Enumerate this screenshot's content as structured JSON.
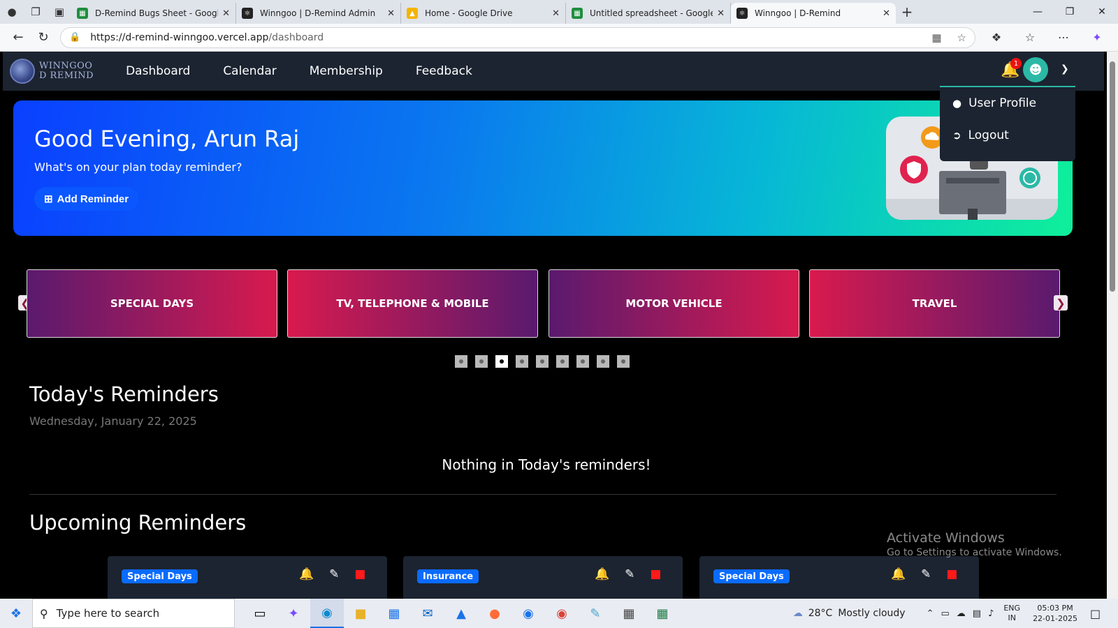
{
  "browser": {
    "tabs": [
      {
        "title": "D-Remind Bugs Sheet - Google Sh",
        "icon": "sheets-icon",
        "color": "#1e8e3e"
      },
      {
        "title": "Winngoo | D-Remind Admin",
        "icon": "react-icon",
        "color": "#222222"
      },
      {
        "title": "Home - Google Drive",
        "icon": "drive-icon",
        "color": "#f4b400"
      },
      {
        "title": "Untitled spreadsheet - Google Sh",
        "icon": "sheets-icon",
        "color": "#1e8e3e"
      },
      {
        "title": "Winngoo | D-Remind",
        "icon": "react-icon",
        "color": "#222222"
      }
    ],
    "url_host": "https://d-remind-winngoo.vercel.app",
    "url_path": "/dashboard"
  },
  "app": {
    "logo_line1": "WINNGOO",
    "logo_line2": "D REMIND",
    "nav": [
      "Dashboard",
      "Calendar",
      "Membership",
      "Feedback"
    ],
    "notification_count": "1",
    "dropdown": {
      "profile": "User Profile",
      "logout": "Logout"
    },
    "hero": {
      "greeting": "Good Evening, Arun Raj",
      "subtitle": "What's on your plan today reminder?",
      "add_button": "Add Reminder"
    },
    "categories": [
      "SPECIAL DAYS",
      "TV, TELEPHONE & MOBILE",
      "MOTOR VEHICLE",
      "TRAVEL"
    ],
    "carousel_dots": 9,
    "carousel_active": 3,
    "today": {
      "title": "Today's Reminders",
      "date": "Wednesday, January 22, 2025",
      "empty": "Nothing in Today's reminders!"
    },
    "upcoming": {
      "title": "Upcoming Reminders",
      "cards": [
        "Special Days",
        "Insurance",
        "Special Days"
      ]
    },
    "watermark": {
      "title": "Activate Windows",
      "sub": "Go to Settings to activate Windows."
    }
  },
  "taskbar": {
    "search_placeholder": "Type here to search",
    "weather_temp": "28°C",
    "weather_text": "Mostly cloudy",
    "lang1": "ENG",
    "lang2": "IN",
    "time": "05:03 PM",
    "date": "22-01-2025"
  },
  "colors": {
    "accent": "#2bb9a6",
    "navbar": "#1c2431",
    "tag": "#0a6bff",
    "alarm": "#1cd06a",
    "delete": "#ff1a1a"
  }
}
